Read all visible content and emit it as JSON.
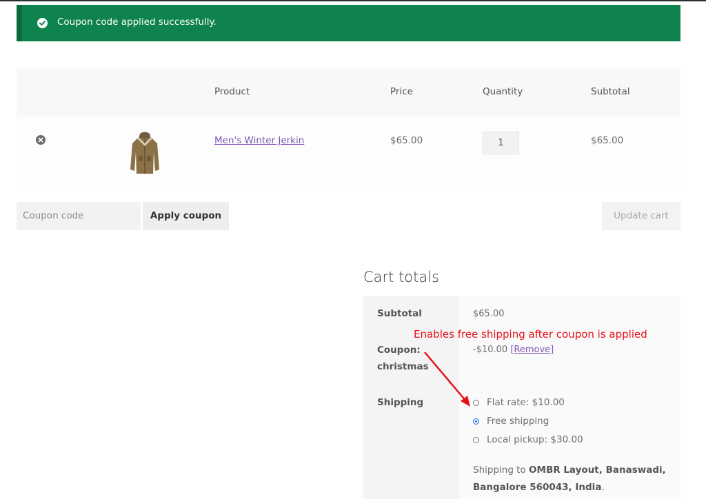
{
  "notice": {
    "message": "Coupon code applied successfully.",
    "icon": "check-circle-icon",
    "color": "#0f834d"
  },
  "cart": {
    "headers": {
      "product": "Product",
      "price": "Price",
      "quantity": "Quantity",
      "subtotal": "Subtotal"
    },
    "items": [
      {
        "name": "Men's Winter Jerkin",
        "price": "$65.00",
        "quantity": "1",
        "subtotal": "$65.00",
        "thumb": "jacket-image"
      }
    ]
  },
  "coupon": {
    "placeholder": "Coupon code",
    "apply_label": "Apply coupon"
  },
  "update_label": "Update cart",
  "totals": {
    "title": "Cart totals",
    "subtotal_label": "Subtotal",
    "subtotal_value": "$65.00",
    "coupon_label_1": "Coupon:",
    "coupon_label_2": "christmas",
    "coupon_value": "-$10.00",
    "remove_label": "[Remove]",
    "shipping_label": "Shipping",
    "shipping_options": [
      {
        "label": "Flat rate: $10.00",
        "selected": false
      },
      {
        "label": "Free shipping",
        "selected": true
      },
      {
        "label": "Local pickup: $30.00",
        "selected": false
      }
    ],
    "shipping_to_prefix": "Shipping to ",
    "shipping_to_address": "OMBR Layout, Banaswadi, Bangalore 560043, India",
    "shipping_to_suffix": "."
  },
  "annotation": {
    "text": "Enables free shipping after coupon is applied",
    "color": "#e8101a"
  },
  "colors": {
    "link": "#7f54b3",
    "accent": "#1a73e8"
  }
}
